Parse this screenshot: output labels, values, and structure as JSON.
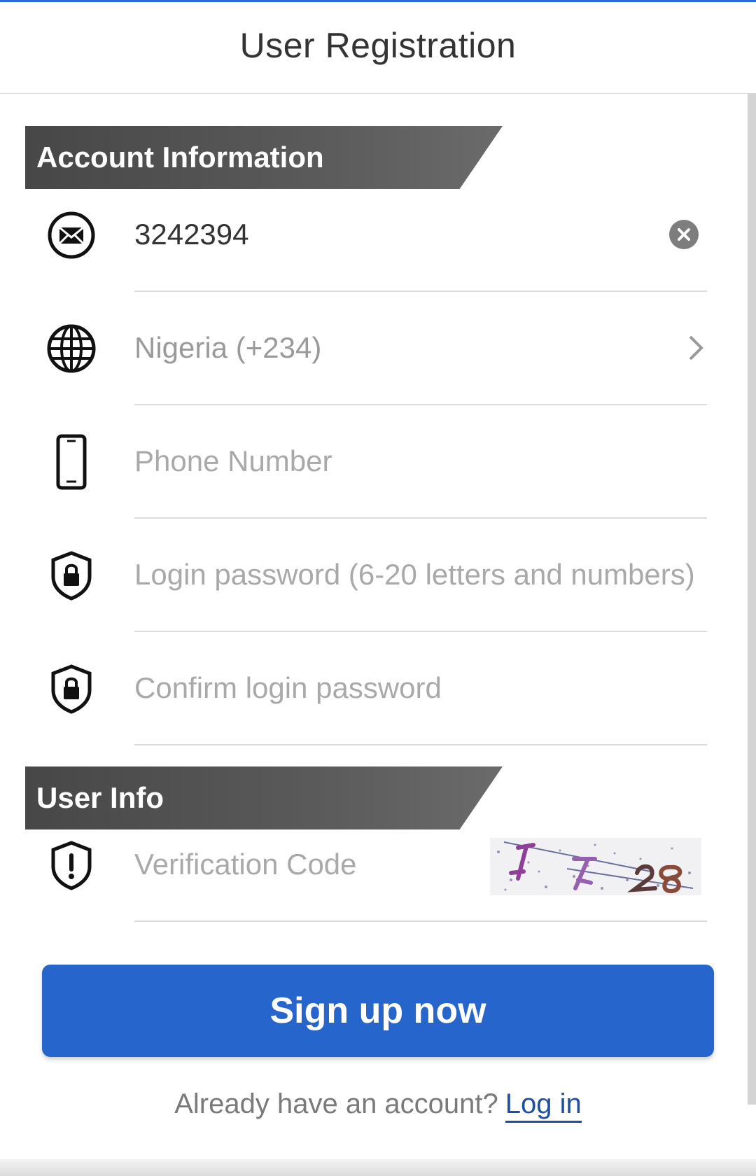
{
  "header": {
    "title": "User Registration"
  },
  "sections": {
    "account": "Account Information",
    "user": "User Info"
  },
  "fields": {
    "account_value": "3242394",
    "country": "Nigeria (+234)",
    "phone_placeholder": "Phone Number",
    "password_placeholder": "Login password (6-20 letters and numbers)",
    "confirm_placeholder": "Confirm login password",
    "verification_placeholder": "Verification Code"
  },
  "actions": {
    "signup": "Sign up now",
    "login_prompt": "Already have an account?",
    "login_link": "Log in"
  },
  "colors": {
    "accent": "#2665cc",
    "banner": "#4a4a4a",
    "link": "#1f4fa3"
  },
  "icons": {
    "account": "envelope-icon",
    "country": "globe-icon",
    "phone": "phone-icon",
    "password": "shield-lock-icon",
    "verify": "shield-alert-icon",
    "clear": "clear-icon",
    "chevron": "chevron-right-icon"
  }
}
